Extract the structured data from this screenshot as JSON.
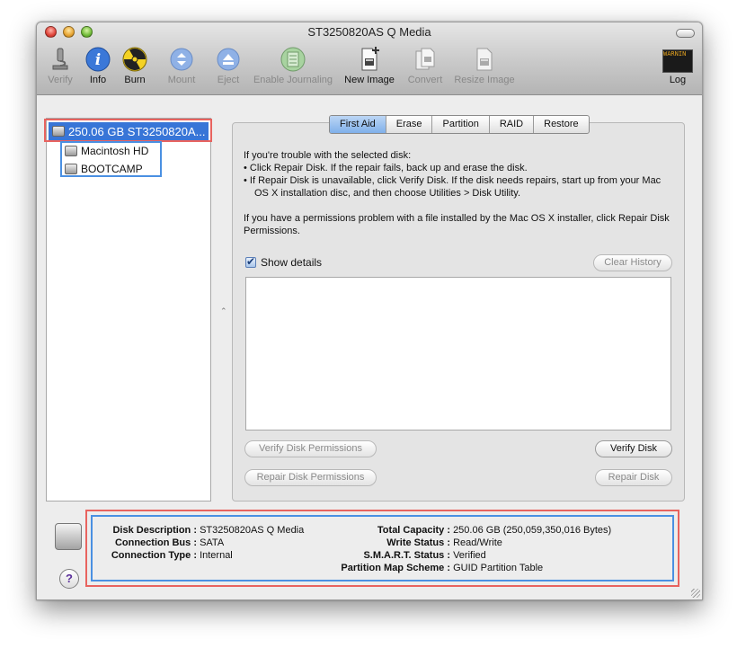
{
  "window": {
    "title": "ST3250820AS Q Media"
  },
  "toolbar": {
    "verify": "Verify",
    "info": "Info",
    "burn": "Burn",
    "mount": "Mount",
    "eject": "Eject",
    "enable_journaling": "Enable Journaling",
    "new_image": "New Image",
    "convert": "Convert",
    "resize_image": "Resize Image",
    "log": "Log",
    "log_icon_text": "WARNIN"
  },
  "sidebar": {
    "disk": "250.06 GB ST3250820A...",
    "volumes": [
      "Macintosh HD",
      "BOOTCAMP"
    ]
  },
  "tabs": [
    "First Aid",
    "Erase",
    "Partition",
    "RAID",
    "Restore"
  ],
  "first_aid": {
    "intro": "If you're trouble with the selected disk:",
    "bullet1": "• Click Repair Disk. If the repair fails, back up and erase the disk.",
    "bullet2": "• If Repair Disk is unavailable, click Verify Disk. If the disk needs repairs, start up from your Mac OS X installation disc, and then choose Utilities > Disk Utility.",
    "permissions_note": "If you have a permissions problem with a file installed by the Mac OS X installer, click Repair Disk Permissions.",
    "show_details": "Show details",
    "clear_history": "Clear History",
    "verify_permissions": "Verify Disk Permissions",
    "verify_disk": "Verify Disk",
    "repair_permissions": "Repair Disk Permissions",
    "repair_disk": "Repair Disk"
  },
  "details": {
    "disk_description_label": "Disk Description :",
    "disk_description": "ST3250820AS Q Media",
    "connection_bus_label": "Connection Bus :",
    "connection_bus": "SATA",
    "connection_type_label": "Connection Type :",
    "connection_type": "Internal",
    "total_capacity_label": "Total Capacity :",
    "total_capacity": "250.06 GB (250,059,350,016 Bytes)",
    "write_status_label": "Write Status :",
    "write_status": "Read/Write",
    "smart_status_label": "S.M.A.R.T. Status :",
    "smart_status": "Verified",
    "partition_scheme_label": "Partition Map Scheme :",
    "partition_scheme": "GUID Partition Table"
  },
  "help": "?"
}
